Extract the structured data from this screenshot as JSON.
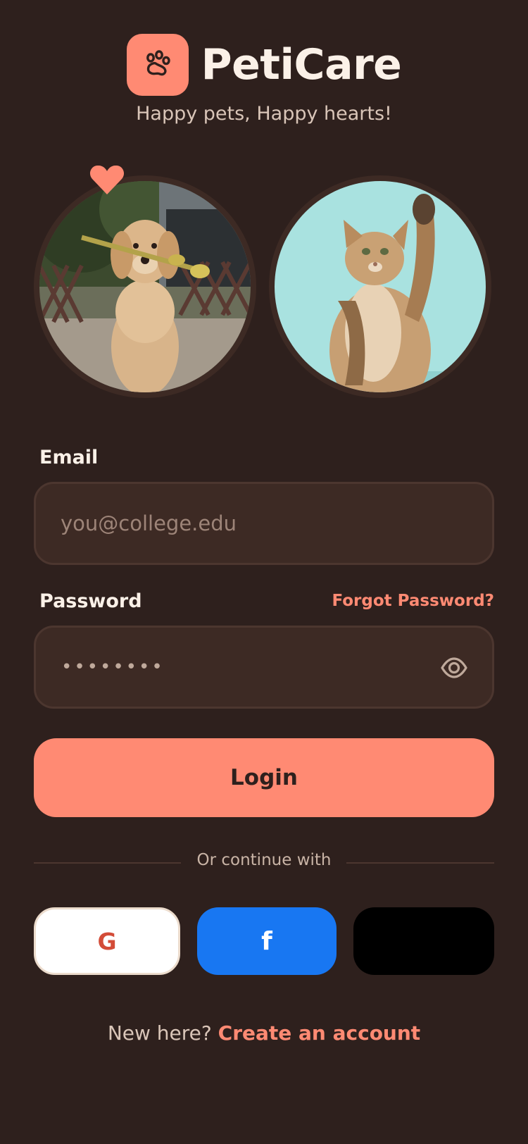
{
  "app": {
    "title": "PetiCare",
    "tagline": "Happy pets, Happy hearts!"
  },
  "icons": {
    "logo": "paw-icon",
    "favorite": "heart-icon",
    "password_toggle": "eye-icon"
  },
  "colors": {
    "background": "#2e201d",
    "accent": "#ff8a73",
    "field": "#3d2a24",
    "facebook": "#1877f2"
  },
  "form": {
    "email_label": "Email",
    "email_placeholder": "you@college.edu",
    "email_value": "",
    "password_label": "Password",
    "password_value": "••••••••",
    "forgot_label": "Forgot Password?",
    "login_label": "Login"
  },
  "social": {
    "divider_text": "Or continue with",
    "google_label": "G",
    "facebook_label": "f"
  },
  "signup": {
    "prompt": "New here?",
    "link": "Create an account"
  }
}
